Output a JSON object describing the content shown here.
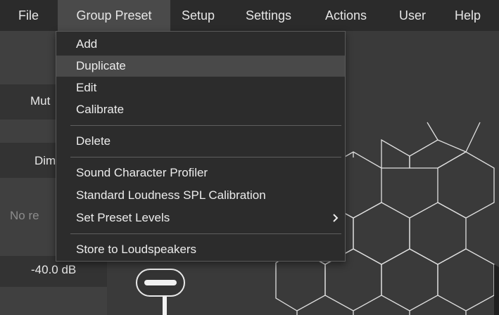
{
  "menubar": {
    "items": [
      "File",
      "Group Preset",
      "Setup",
      "Settings",
      "Actions",
      "User",
      "Help"
    ],
    "active": "Group Preset"
  },
  "left_panel": {
    "mute_label": "Mut",
    "dim_label": "Dim",
    "status_text": "No re",
    "level_value": "-40.0 dB"
  },
  "dropdown": {
    "items": [
      {
        "label": "Add"
      },
      {
        "label": "Duplicate"
      },
      {
        "label": "Edit"
      },
      {
        "label": "Calibrate"
      },
      {
        "label": "Delete"
      },
      {
        "label": "Sound Character Profiler"
      },
      {
        "label": "Standard Loudness SPL Calibration"
      },
      {
        "label": "Set Preset Levels",
        "submenu_icon": "chevron-right-icon"
      },
      {
        "label": "Store to Loudspeakers"
      }
    ],
    "highlighted": "Duplicate"
  },
  "icons": {
    "submenu_chevron": "chevron-right-icon",
    "fader": "fader-knob-icon"
  },
  "colors": {
    "menubar_bg": "#2b2b2b",
    "menu_bg": "#2c2c2c",
    "highlight": "#494949",
    "hex_line": "#e0e0e0"
  }
}
